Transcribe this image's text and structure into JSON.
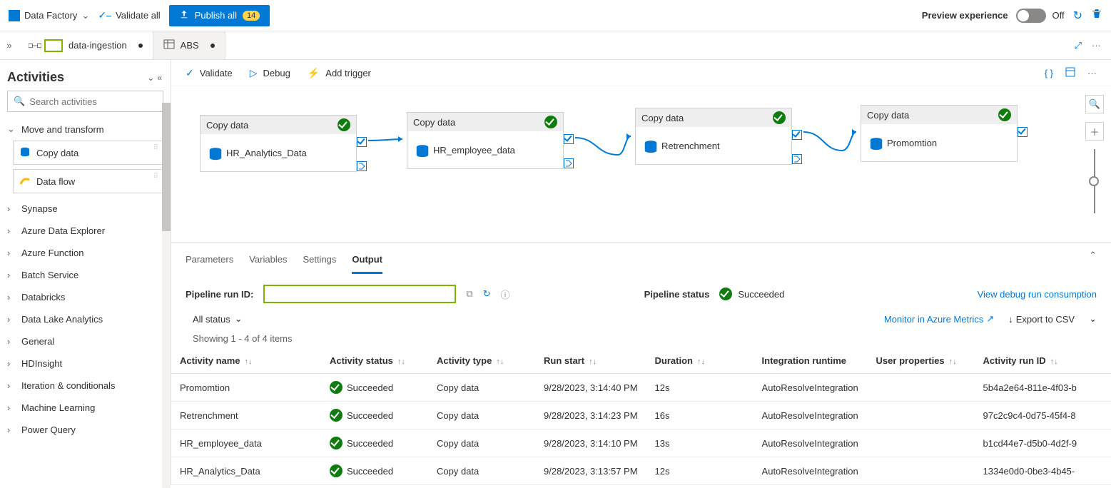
{
  "topbar": {
    "brand": "Data Factory",
    "validate_all": "Validate all",
    "publish": "Publish all",
    "publish_count": "14",
    "preview_label": "Preview experience",
    "toggle_state": "Off"
  },
  "tabs": {
    "pipeline_name": "data-ingestion",
    "second_tab": "ABS"
  },
  "sidebar": {
    "title": "Activities",
    "search_placeholder": "Search activities",
    "group_move_transform": "Move and transform",
    "copy_data": "Copy data",
    "data_flow": "Data flow",
    "categories": [
      "Synapse",
      "Azure Data Explorer",
      "Azure Function",
      "Batch Service",
      "Databricks",
      "Data Lake Analytics",
      "General",
      "HDInsight",
      "Iteration & conditionals",
      "Machine Learning",
      "Power Query"
    ]
  },
  "toolbar": {
    "validate": "Validate",
    "debug": "Debug",
    "add_trigger": "Add trigger"
  },
  "canvas": {
    "node_type": "Copy data",
    "nodes": [
      "HR_Analytics_Data",
      "HR_employee_data",
      "Retrenchment",
      "Promomtion"
    ]
  },
  "panel": {
    "tabs": [
      "Parameters",
      "Variables",
      "Settings",
      "Output"
    ],
    "active_tab": "Output",
    "run_id_label": "Pipeline run ID:",
    "status_label": "Pipeline status",
    "status_value": "Succeeded",
    "consumption_link": "View debug run consumption",
    "status_filter": "All status",
    "monitor_link": "Monitor in Azure Metrics",
    "export_link": "Export to CSV",
    "showing": "Showing 1 - 4 of 4 items",
    "columns": {
      "name": "Activity name",
      "status": "Activity status",
      "type": "Activity type",
      "start": "Run start",
      "duration": "Duration",
      "runtime": "Integration runtime",
      "props": "User properties",
      "runid": "Activity run ID"
    },
    "rows": [
      {
        "name": "Promomtion",
        "status": "Succeeded",
        "type": "Copy data",
        "start": "9/28/2023, 3:14:40 PM",
        "duration": "12s",
        "runtime": "AutoResolveIntegration",
        "runid": "5b4a2e64-811e-4f03-b"
      },
      {
        "name": "Retrenchment",
        "status": "Succeeded",
        "type": "Copy data",
        "start": "9/28/2023, 3:14:23 PM",
        "duration": "16s",
        "runtime": "AutoResolveIntegration",
        "runid": "97c2c9c4-0d75-45f4-8"
      },
      {
        "name": "HR_employee_data",
        "status": "Succeeded",
        "type": "Copy data",
        "start": "9/28/2023, 3:14:10 PM",
        "duration": "13s",
        "runtime": "AutoResolveIntegration",
        "runid": "b1cd44e7-d5b0-4d2f-9"
      },
      {
        "name": "HR_Analytics_Data",
        "status": "Succeeded",
        "type": "Copy data",
        "start": "9/28/2023, 3:13:57 PM",
        "duration": "12s",
        "runtime": "AutoResolveIntegration",
        "runid": "1334e0d0-0be3-4b45-"
      }
    ]
  }
}
